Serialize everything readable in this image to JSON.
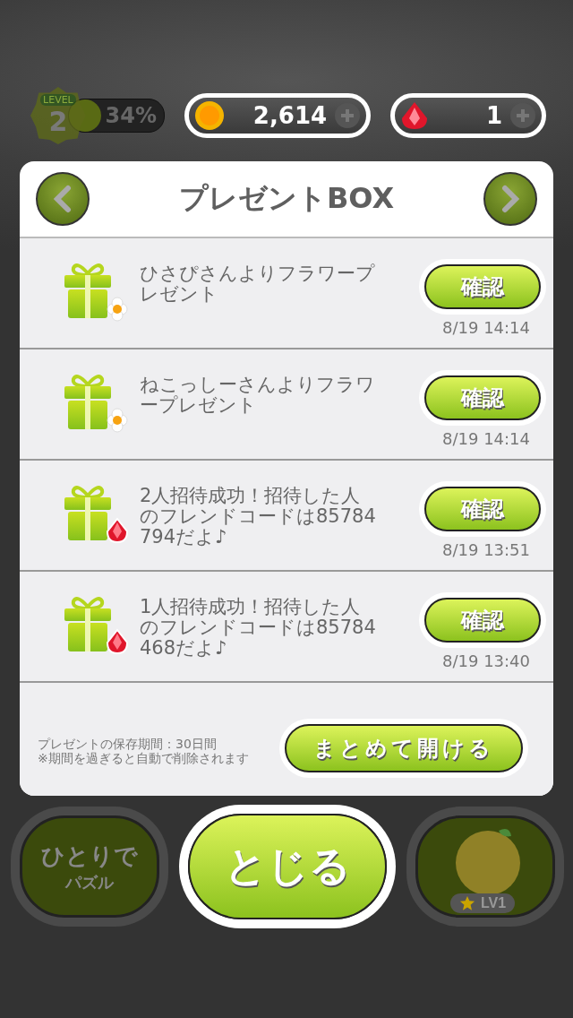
{
  "hud": {
    "level_label": "LEVEL",
    "level": "2",
    "progress": {
      "text": "34%",
      "level": 0.34
    },
    "coins": "2,614",
    "gems": "1"
  },
  "dialog": {
    "title": "プレゼントBOX",
    "presents": [
      {
        "kind": "flower",
        "message": "ひさぴさんよりフラワープレゼント",
        "button": "確認",
        "time": "8/19 14:14"
      },
      {
        "kind": "flower",
        "message": "ねこっしーさんよりフラワープレゼント",
        "button": "確認",
        "time": "8/19 14:14"
      },
      {
        "kind": "gem",
        "message": "2人招待成功！招待した人のフレンドコードは85784794だよ♪",
        "button": "確認",
        "time": "8/19 13:51"
      },
      {
        "kind": "gem",
        "message": "1人招待成功！招待した人のフレンドコードは85784468だよ♪",
        "button": "確認",
        "time": "8/19 13:40"
      }
    ],
    "notes": [
      "プレゼントの保存期間：30日間",
      "※期間を過ぎると自動で削除されます"
    ],
    "open_all_button": "まとめて開ける"
  },
  "bottom": {
    "solo_line1": "ひとりで",
    "solo_line2": "パズル",
    "close_button": "とじる",
    "avatar_level": "LV1"
  }
}
